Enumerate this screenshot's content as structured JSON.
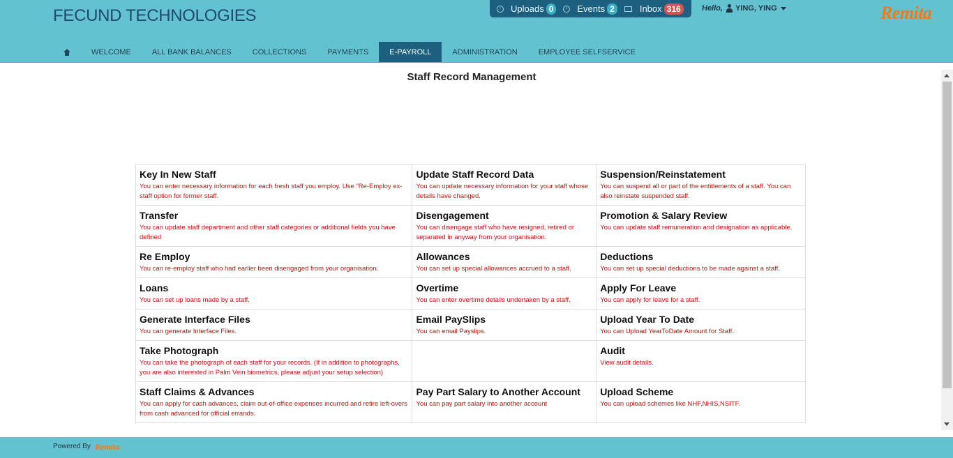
{
  "brand": "FECUND TECHNOLOGIES",
  "notifications": [
    {
      "label": "Uploads",
      "count": "0"
    },
    {
      "label": "Events",
      "count": "2"
    },
    {
      "label": "Inbox",
      "count": "316"
    }
  ],
  "user": {
    "greeting": "Hello,",
    "name": "YING, YING"
  },
  "logo": "Remita",
  "nav": [
    "WELCOME",
    "ALL BANK BALANCES",
    "COLLECTIONS",
    "PAYMENTS",
    "E-PAYROLL",
    "ADMINISTRATION",
    "EMPLOYEE SELFSERVICE"
  ],
  "page_title": "Staff Record Management",
  "rows": [
    [
      {
        "title": "Key In New Staff",
        "desc": "You can enter necessary information for each fresh staff you employ. Use \"Re-Employ ex-staff option for former staff."
      },
      {
        "title": "Update Staff Record Data",
        "desc": "You can update necessary information for your staff whose details have changed."
      },
      {
        "title": "Suspension/Reinstatement",
        "desc": "You can suspend all or part of the entitlements of a staff. You can also reinstate suspended staff."
      }
    ],
    [
      {
        "title": "Transfer",
        "desc": "You can update staff department and other staff categories or additional fields you have defined"
      },
      {
        "title": "Disengagement",
        "desc": "You can disengage staff who have resigned, retired or separated in anyway from your organisation."
      },
      {
        "title": "Promotion & Salary Review",
        "desc": "You can update staff remuneration and designation as applicable."
      }
    ],
    [
      {
        "title": "Re Employ",
        "desc": "You can re-employ staff who had earlier been disengaged from your organisation."
      },
      {
        "title": "Allowances",
        "desc": "You can set up special allowances accrued to a staff."
      },
      {
        "title": "Deductions",
        "desc": "You can set up special deductions to be made against a staff."
      }
    ],
    [
      {
        "title": "Loans",
        "desc": "You can set up loans made by a staff."
      },
      {
        "title": "Overtime",
        "desc": "You can enter overtime details undertaken by a staff."
      },
      {
        "title": "Apply For Leave",
        "desc": "You can apply for leave for a staff."
      }
    ],
    [
      {
        "title": "Generate Interface Files",
        "desc": "You can generate Interface Files."
      },
      {
        "title": "Email PaySlips",
        "desc": "You can email Payslips."
      },
      {
        "title": "Upload Year To Date",
        "desc": "You can Upload YearToDate Amount for Staff."
      }
    ],
    [
      {
        "title": "Take Photograph",
        "desc": "You can take the photograph of each staff for your records. (If in addition to photographs, you are also interested in Palm Vein biometrics, please adjust your setup selection)"
      },
      {
        "title": "",
        "desc": ""
      },
      {
        "title": "Audit",
        "desc": "View audit details."
      }
    ],
    [
      {
        "title": "Staff Claims & Advances",
        "desc": "You can apply for cash advances, claim out-of-office expenses incurred and retire left-overs from cash advanced for official errands."
      },
      {
        "title": "Pay Part Salary to Another Account",
        "desc": "You can pay part salary into another account"
      },
      {
        "title": "Upload Scheme",
        "desc": "You can upload schemes like NHF,NHIS,NSITF."
      }
    ]
  ],
  "footer": {
    "powered_by": "Powered By",
    "logo": "Remita"
  }
}
